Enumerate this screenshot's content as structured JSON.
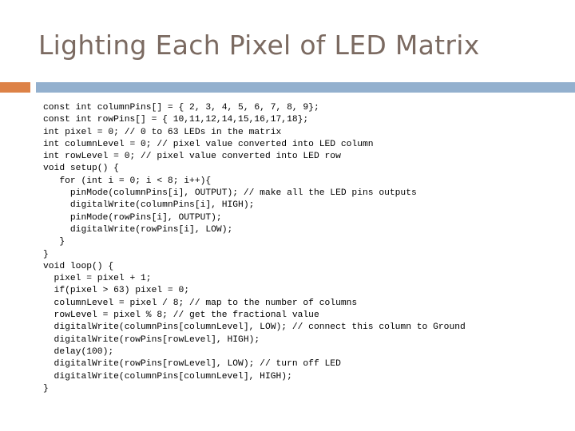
{
  "slide": {
    "title": "Lighting Each Pixel of LED Matrix",
    "accent_color": "#dd8247",
    "bar_color": "#93b0ce",
    "title_color": "#7b6a61",
    "background_color": "#ffffff",
    "code_color": "#000000"
  },
  "code": {
    "language": "arduino-c",
    "lines": [
      "const int columnPins[] = { 2, 3, 4, 5, 6, 7, 8, 9};",
      "const int rowPins[] = { 10,11,12,14,15,16,17,18};",
      "int pixel = 0; // 0 to 63 LEDs in the matrix",
      "int columnLevel = 0; // pixel value converted into LED column",
      "int rowLevel = 0; // pixel value converted into LED row",
      "void setup() {",
      "   for (int i = 0; i < 8; i++){",
      "     pinMode(columnPins[i], OUTPUT); // make all the LED pins outputs",
      "     digitalWrite(columnPins[i], HIGH);",
      "     pinMode(rowPins[i], OUTPUT);",
      "     digitalWrite(rowPins[i], LOW);",
      "   }",
      "}",
      "void loop() {",
      "  pixel = pixel + 1;",
      "  if(pixel > 63) pixel = 0;",
      "  columnLevel = pixel / 8; // map to the number of columns",
      "  rowLevel = pixel % 8; // get the fractional value",
      "  digitalWrite(columnPins[columnLevel], LOW); // connect this column to Ground",
      "  digitalWrite(rowPins[rowLevel], HIGH);",
      "  delay(100);",
      "  digitalWrite(rowPins[rowLevel], LOW); // turn off LED",
      "  digitalWrite(columnPins[columnLevel], HIGH);",
      "}"
    ]
  }
}
